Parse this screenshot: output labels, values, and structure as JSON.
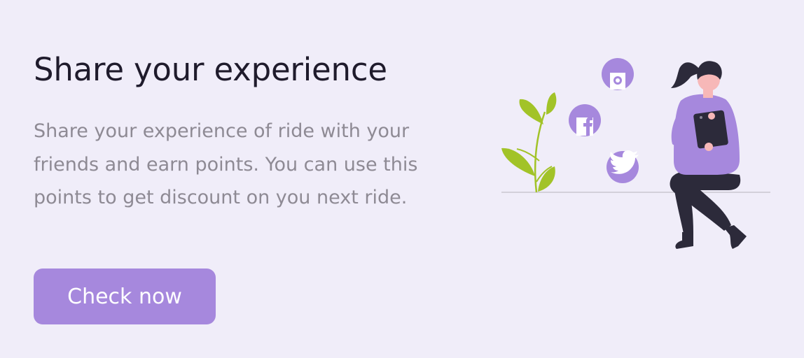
{
  "promo": {
    "title": "Share your experience",
    "description": "Share your experience of ride with your friends and earn points. You can use this points to get discount on you next ride.",
    "cta_label": "Check now"
  },
  "colors": {
    "background": "#f0edf9",
    "accent": "#a688dd",
    "title_text": "#1f1b2c",
    "body_text": "#8e8a94",
    "plant": "#a2c328",
    "figure_dark": "#2c2a3a"
  },
  "icons": [
    "instagram-icon",
    "facebook-icon",
    "twitter-icon"
  ]
}
